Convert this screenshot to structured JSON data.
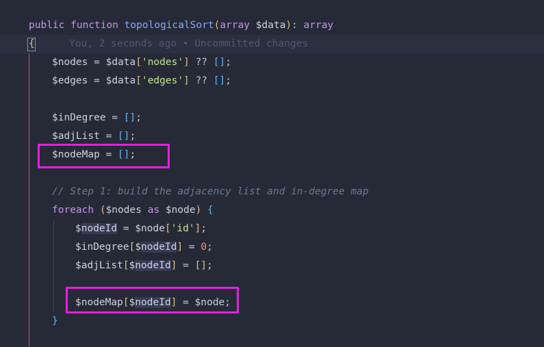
{
  "code": {
    "line_signature": {
      "kw1": "public",
      "kw2": "function",
      "name": "topologicalSort",
      "paren_open": "(",
      "type": "array",
      "param": "$data",
      "paren_close": ")",
      "colon": ":",
      "ret": "array"
    },
    "line_open_brace": {
      "brace": "{",
      "blame": "You, 2 seconds ago • Uncommitted changes"
    },
    "line_nodes": {
      "var": "$nodes",
      "eq": "=",
      "src": "$data",
      "b_open": "[",
      "key": "'nodes'",
      "b_close": "]",
      "op": "??",
      "empty_open": "[",
      "empty_close": "]",
      "semi": ";"
    },
    "line_edges": {
      "var": "$edges",
      "eq": "=",
      "src": "$data",
      "b_open": "[",
      "key": "'edges'",
      "b_close": "]",
      "op": "??",
      "empty_open": "[",
      "empty_close": "]",
      "semi": ";"
    },
    "line_indegree": {
      "var": "$inDegree",
      "eq": "=",
      "empty_open": "[",
      "empty_close": "]",
      "semi": ";"
    },
    "line_adjlist": {
      "var": "$adjList",
      "eq": "=",
      "empty_open": "[",
      "empty_close": "]",
      "semi": ";"
    },
    "line_nodemap": {
      "var": "$nodeMap",
      "eq": "=",
      "empty_open": "[",
      "empty_close": "]",
      "semi": ";"
    },
    "line_comment": {
      "text": "// Step 1: build the adjacency list and in-degree map"
    },
    "line_foreach": {
      "kw": "foreach",
      "paren_open": "(",
      "iter": "$nodes",
      "as": "as",
      "item": "$node",
      "paren_close": ")",
      "brace": "{"
    },
    "line_nodeid": {
      "dollar": "$",
      "var": "nodeId",
      "eq": "=",
      "src": "$node",
      "b_open": "[",
      "key": "'id'",
      "b_close": "]",
      "semi": ";"
    },
    "line_indegree_set": {
      "target": "$inDegree",
      "b_open": "[",
      "dollar": "$",
      "idx": "nodeId",
      "b_close": "]",
      "eq": "=",
      "val": "0",
      "semi": ";"
    },
    "line_adjlist_set": {
      "target": "$adjList",
      "b_open": "[",
      "dollar": "$",
      "idx": "nodeId",
      "b_close": "]",
      "eq": "=",
      "empty_open": "[",
      "empty_close": "]",
      "semi": ";"
    },
    "line_nodemap_set": {
      "target": "$nodeMap",
      "b_open": "[",
      "dollar": "$",
      "idx": "nodeId",
      "b_close": "]",
      "eq": "=",
      "val": "$node",
      "semi": ";"
    },
    "line_close_brace": {
      "brace": "}"
    }
  },
  "colors": {
    "background": "#262a37",
    "keyword": "#c792ea",
    "function": "#82aaff",
    "string": "#c3e88d",
    "number": "#f78c6c",
    "comment": "#6c7796",
    "annotation_highlight": "#e61fe0"
  }
}
